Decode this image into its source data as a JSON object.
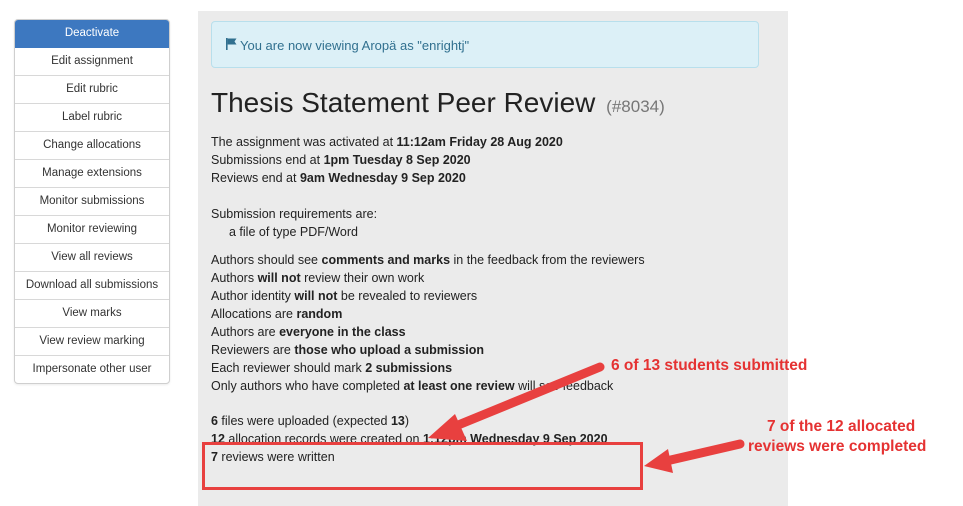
{
  "sidebar": {
    "items": [
      {
        "label": "Deactivate",
        "active": true
      },
      {
        "label": "Edit assignment"
      },
      {
        "label": "Edit rubric"
      },
      {
        "label": "Label rubric"
      },
      {
        "label": "Change allocations"
      },
      {
        "label": "Manage extensions"
      },
      {
        "label": "Monitor submissions"
      },
      {
        "label": "Monitor reviewing"
      },
      {
        "label": "View all reviews"
      },
      {
        "label": "Download all submissions"
      },
      {
        "label": "View marks"
      },
      {
        "label": "View review marking"
      },
      {
        "label": "Impersonate other user"
      }
    ]
  },
  "alert": {
    "icon": "flag-icon",
    "text": "You are now viewing Aropä as \"enrightj\""
  },
  "title": {
    "main": "Thesis Statement Peer Review",
    "number": "(#8034)"
  },
  "dates": {
    "activated_prefix": "The assignment was activated at ",
    "activated": "11:12am Friday 28 Aug 2020",
    "submissions_prefix": "Submissions end at ",
    "submissions": "1pm Tuesday 8 Sep 2020",
    "reviews_prefix": "Reviews end at ",
    "reviews": "9am Wednesday 9 Sep 2020"
  },
  "requirements": {
    "heading": "Submission requirements are:",
    "item": "a file of type PDF/Word"
  },
  "settings": {
    "s1a": "Authors should see ",
    "s1b": "comments and marks",
    "s1c": " in the feedback from the reviewers",
    "s2a": "Authors ",
    "s2b": "will not",
    "s2c": " review their own work",
    "s3a": "Author identity ",
    "s3b": "will not",
    "s3c": " be revealed to reviewers",
    "s4a": "Allocations are ",
    "s4b": "random",
    "s5a": "Authors are ",
    "s5b": "everyone in the class",
    "s6a": "Reviewers are ",
    "s6b": "those who upload a submission",
    "s7a": "Each reviewer should mark ",
    "s7b": "2 submissions",
    "s8a": "Only authors who have completed ",
    "s8b": "at least one review",
    "s8c": " will see feedback"
  },
  "stats": {
    "files": "6",
    "files_text": " files were uploaded (expected ",
    "expected": "13",
    "files_close": ")",
    "alloc": "12",
    "alloc_text": " allocation records were created on ",
    "alloc_date": "1:12pm Wednesday 9 Sep 2020",
    "reviews": "7",
    "reviews_text": " reviews were written"
  },
  "annotations": {
    "callout1": "6 of 13 students submitted",
    "callout2_line1": "7 of the 12 allocated",
    "callout2_line2": "reviews were completed",
    "color": "#e53232"
  }
}
